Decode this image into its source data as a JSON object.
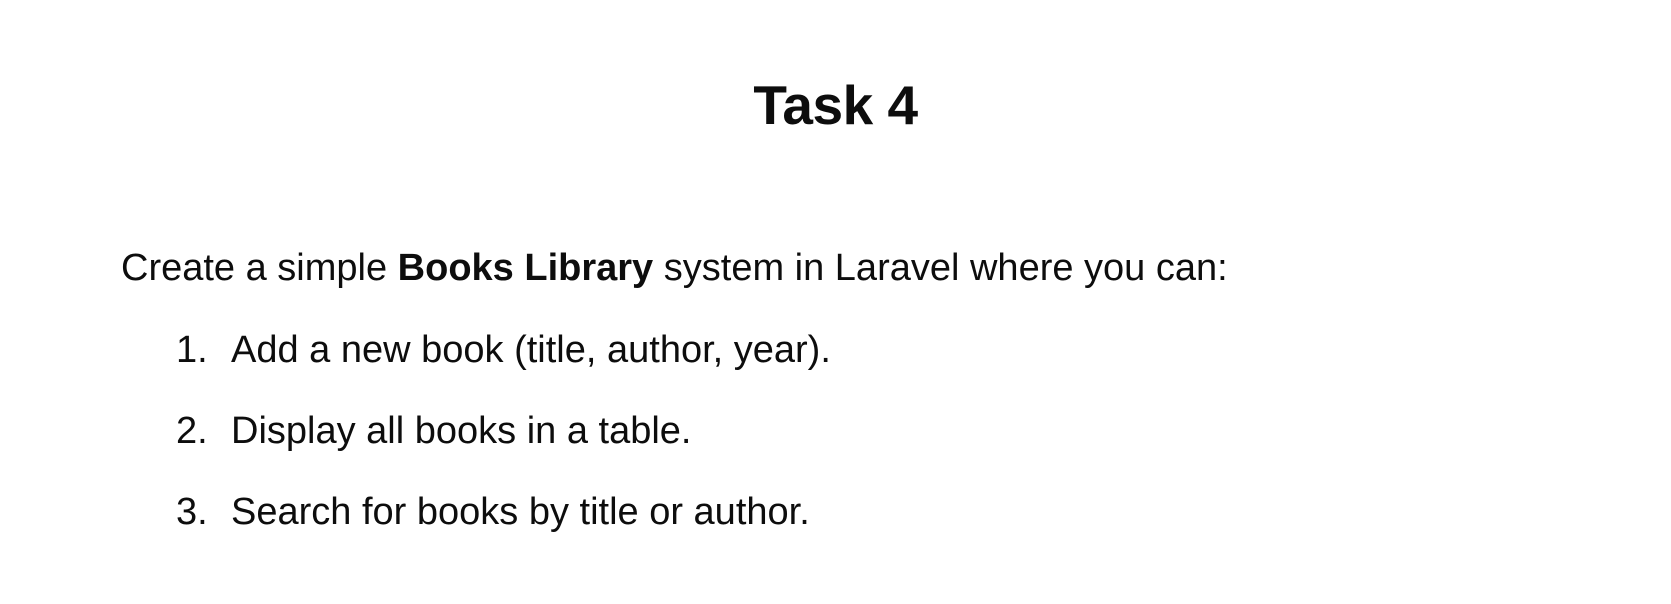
{
  "document": {
    "title": "Task 4",
    "intro": {
      "before": "Create a simple ",
      "bold": "Books Library",
      "after": " system in Laravel where you can:"
    },
    "items": [
      {
        "number": "1.",
        "text": "Add a new book (title, author, year)."
      },
      {
        "number": "2.",
        "text": "Display all books in a table."
      },
      {
        "number": "3.",
        "text": "Search for books by title or author."
      }
    ]
  }
}
